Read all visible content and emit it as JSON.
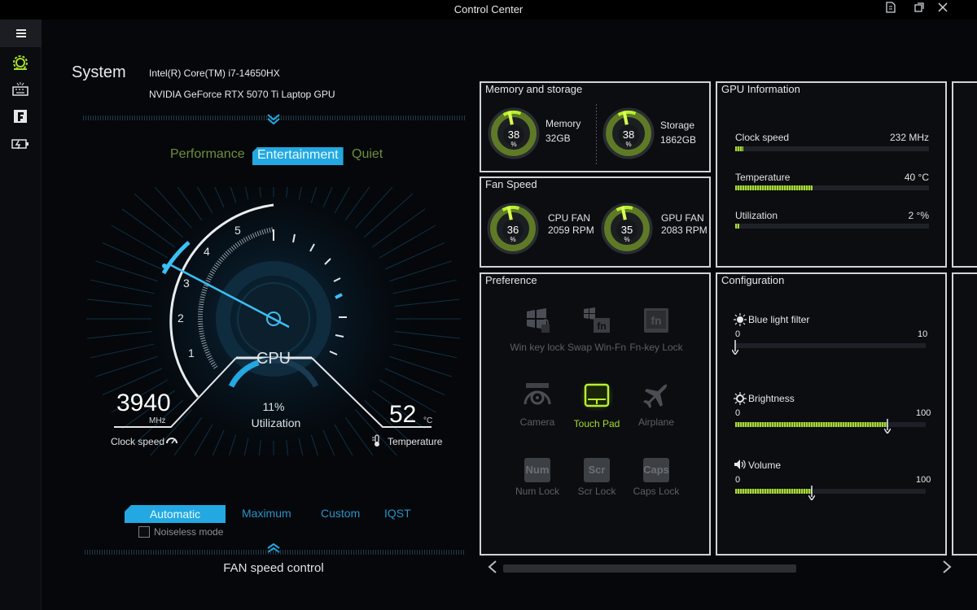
{
  "window": {
    "title": "Control Center"
  },
  "system": {
    "title": "System",
    "cpu": "Intel(R) Core(TM) i7-14650HX",
    "gpu": "NVIDIA GeForce RTX 5070 Ti Laptop GPU"
  },
  "modes": [
    "Performance",
    "Entertainment",
    "Quiet"
  ],
  "gauge": {
    "ticks": [
      "1",
      "2",
      "3",
      "4",
      "5"
    ],
    "center_label": "CPU",
    "clock_value": "3940",
    "clock_unit": "MHz",
    "clock_caption": "Clock speed",
    "util_value": "11%",
    "util_caption": "Utilization",
    "temp_value": "52",
    "temp_unit": "°C",
    "temp_caption": "Temperature",
    "util_fraction": 0.11
  },
  "fan": {
    "tabs": [
      "Automatic",
      "Maximum",
      "Custom",
      "IQST"
    ],
    "noiseless": "Noiseless mode",
    "title": "FAN speed control"
  },
  "memory": {
    "title": "Memory and storage",
    "mem_label": "Memory",
    "mem_value": "32GB",
    "mem_pct": "38",
    "mem_fraction": 0.38,
    "sto_label": "Storage",
    "sto_value": "1862GB",
    "sto_pct": "38",
    "sto_fraction": 0.38,
    "pct_symbol": "%"
  },
  "fanspeed": {
    "title": "Fan Speed",
    "cpu_label": "CPU FAN",
    "cpu_rpm": "2059 RPM",
    "cpu_pct": "36",
    "cpu_fraction": 0.36,
    "gpu_label": "GPU FAN",
    "gpu_rpm": "2083 RPM",
    "gpu_pct": "35",
    "gpu_fraction": 0.35
  },
  "gpuinfo": {
    "title": "GPU Information",
    "clock_label": "Clock speed",
    "clock_value": "232 MHz",
    "clock_fraction": 0.04,
    "temp_label": "Temperature",
    "temp_value": "40 °C",
    "temp_fraction": 0.4,
    "util_label": "Utilization",
    "util_value": "2 °%",
    "util_fraction": 0.02
  },
  "preference": {
    "title": "Preference",
    "items": [
      {
        "label": "Win key lock",
        "icon": "windows-lock-icon",
        "active": false
      },
      {
        "label": "Swap Win-Fn",
        "icon": "swap-win-fn-icon",
        "active": false
      },
      {
        "label": "Fn-key Lock",
        "icon": "fn-lock-icon",
        "active": false
      },
      {
        "label": "Camera",
        "icon": "camera-icon",
        "active": false
      },
      {
        "label": "Touch Pad",
        "icon": "touchpad-icon",
        "active": true
      },
      {
        "label": "Airplane",
        "icon": "airplane-icon",
        "active": false
      },
      {
        "label": "Num Lock",
        "icon": "num-lock-icon",
        "active": false,
        "key": "Num"
      },
      {
        "label": "Scr Lock",
        "icon": "scroll-lock-icon",
        "active": false,
        "key": "Scr"
      },
      {
        "label": "Caps Lock",
        "icon": "caps-lock-icon",
        "active": false,
        "key": "Caps"
      }
    ]
  },
  "configuration": {
    "title": "Configuration",
    "blue_label": "Blue light filter",
    "blue_min": "0",
    "blue_max": "10",
    "blue_fraction": 0.0,
    "bright_label": "Brightness",
    "bright_min": "0",
    "bright_max": "100",
    "bright_fraction": 0.8,
    "vol_label": "Volume",
    "vol_min": "0",
    "vol_max": "100",
    "vol_fraction": 0.4
  },
  "colors": {
    "accent_blue": "#23a8e2",
    "accent_green": "#a7d83a",
    "panel_border": "#cfd4d9"
  }
}
